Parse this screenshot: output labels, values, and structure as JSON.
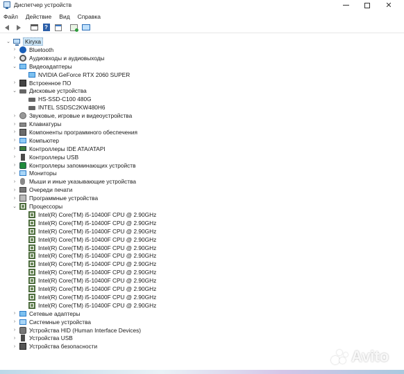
{
  "window": {
    "title": "Диспетчер устройств",
    "minimize_glyph": "—",
    "close_glyph": "✕"
  },
  "menu": [
    "Файл",
    "Действие",
    "Вид",
    "Справка"
  ],
  "toolbar": {
    "icons": [
      "back-icon",
      "forward-icon",
      "properties-icon",
      "help-icon",
      "view-icon",
      "update-driver-icon",
      "scan-hardware-icon"
    ],
    "help_glyph": "?"
  },
  "tree": {
    "root": "Kiryxa",
    "items": [
      {
        "label": "Bluetooth",
        "icon": "bluetooth-icon",
        "expanded": false
      },
      {
        "label": "Аудиовходы и аудиовыходы",
        "icon": "audio-icon",
        "expanded": false
      },
      {
        "label": "Видеоадаптеры",
        "icon": "display-adapter-icon",
        "expanded": true,
        "children": [
          "NVIDIA GeForce RTX 2060 SUPER"
        ]
      },
      {
        "label": "Встроенное ПО",
        "icon": "firmware-icon",
        "expanded": false
      },
      {
        "label": "Дисковые устройства",
        "icon": "disk-icon",
        "expanded": true,
        "children": [
          "HS-SSD-C100 480G",
          "INTEL SSDSC2KW480H6"
        ]
      },
      {
        "label": "Звуковые, игровые и видеоустройства",
        "icon": "sound-icon",
        "expanded": false
      },
      {
        "label": "Клавиатуры",
        "icon": "keyboard-icon",
        "expanded": false
      },
      {
        "label": "Компоненты программного обеспечения",
        "icon": "software-component-icon",
        "expanded": false
      },
      {
        "label": "Компьютер",
        "icon": "computer-icon",
        "expanded": false
      },
      {
        "label": "Контроллеры IDE ATA/ATAPI",
        "icon": "ide-controller-icon",
        "expanded": false
      },
      {
        "label": "Контроллеры USB",
        "icon": "usb-controller-icon",
        "expanded": false
      },
      {
        "label": "Контроллеры запоминающих устройств",
        "icon": "storage-controller-icon",
        "expanded": false
      },
      {
        "label": "Мониторы",
        "icon": "monitor-icon",
        "expanded": false
      },
      {
        "label": "Мыши и иные указывающие устройства",
        "icon": "mouse-icon",
        "expanded": false
      },
      {
        "label": "Очереди печати",
        "icon": "print-queue-icon",
        "expanded": false
      },
      {
        "label": "Программные устройства",
        "icon": "software-device-icon",
        "expanded": false
      },
      {
        "label": "Процессоры",
        "icon": "processor-icon",
        "expanded": true,
        "children": [
          "Intel(R) Core(TM) i5-10400F CPU @ 2.90GHz",
          "Intel(R) Core(TM) i5-10400F CPU @ 2.90GHz",
          "Intel(R) Core(TM) i5-10400F CPU @ 2.90GHz",
          "Intel(R) Core(TM) i5-10400F CPU @ 2.90GHz",
          "Intel(R) Core(TM) i5-10400F CPU @ 2.90GHz",
          "Intel(R) Core(TM) i5-10400F CPU @ 2.90GHz",
          "Intel(R) Core(TM) i5-10400F CPU @ 2.90GHz",
          "Intel(R) Core(TM) i5-10400F CPU @ 2.90GHz",
          "Intel(R) Core(TM) i5-10400F CPU @ 2.90GHz",
          "Intel(R) Core(TM) i5-10400F CPU @ 2.90GHz",
          "Intel(R) Core(TM) i5-10400F CPU @ 2.90GHz",
          "Intel(R) Core(TM) i5-10400F CPU @ 2.90GHz"
        ]
      },
      {
        "label": "Сетевые адаптеры",
        "icon": "network-adapter-icon",
        "expanded": false
      },
      {
        "label": "Системные устройства",
        "icon": "system-device-icon",
        "expanded": false
      },
      {
        "label": "Устройства HID (Human Interface Devices)",
        "icon": "hid-icon",
        "expanded": false
      },
      {
        "label": "Устройства USB",
        "icon": "usb-device-icon",
        "expanded": false
      },
      {
        "label": "Устройства безопасности",
        "icon": "security-device-icon",
        "expanded": false
      }
    ]
  },
  "watermark": {
    "text": "Avito"
  }
}
